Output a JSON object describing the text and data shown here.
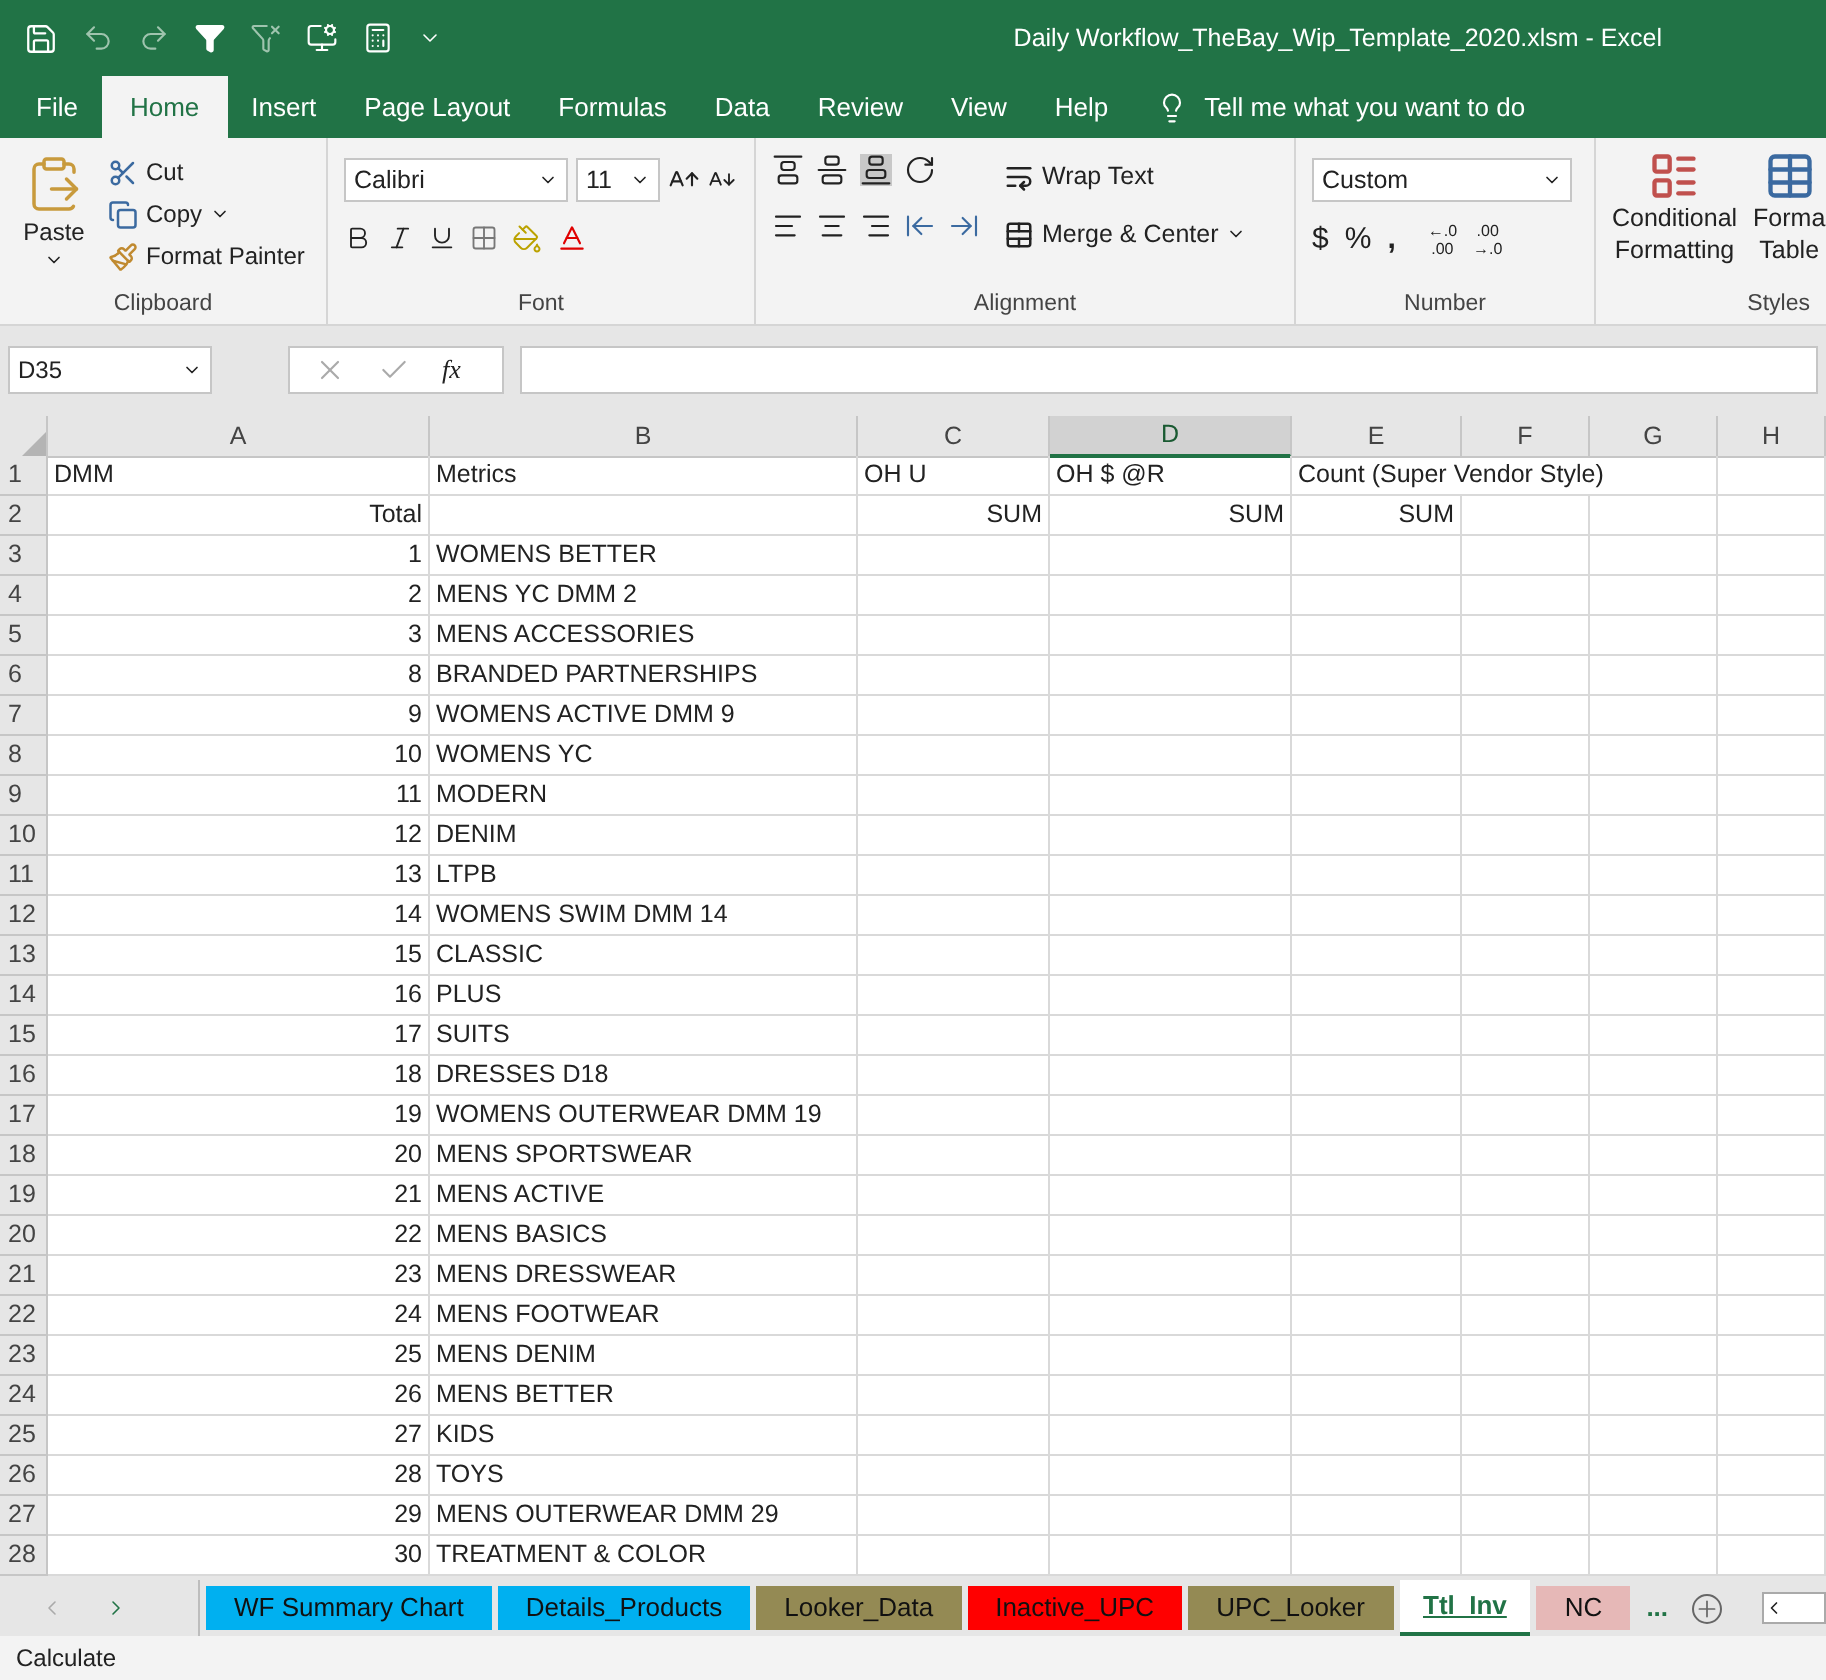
{
  "window": {
    "title": "Daily Workflow_TheBay_Wip_Template_2020.xlsm  -  Excel"
  },
  "menu_tabs": [
    {
      "label": "File",
      "selected": false
    },
    {
      "label": "Home",
      "selected": true
    },
    {
      "label": "Insert",
      "selected": false
    },
    {
      "label": "Page Layout",
      "selected": false
    },
    {
      "label": "Formulas",
      "selected": false
    },
    {
      "label": "Data",
      "selected": false
    },
    {
      "label": "Review",
      "selected": false
    },
    {
      "label": "View",
      "selected": false
    },
    {
      "label": "Help",
      "selected": false
    }
  ],
  "tell_me": "Tell me what you want to do",
  "ribbon": {
    "clipboard": {
      "label": "Clipboard",
      "paste": "Paste",
      "cut": "Cut",
      "copy": "Copy",
      "format_painter": "Format Painter"
    },
    "font": {
      "label": "Font",
      "font_name": "Calibri",
      "font_size": "11"
    },
    "alignment": {
      "label": "Alignment",
      "wrap_text": "Wrap Text",
      "merge_center": "Merge & Center"
    },
    "number": {
      "label": "Number",
      "format": "Custom",
      "currency": "$",
      "percent": "%",
      "comma": ",",
      "increase_decimal": [
        "←.0",
        ".00"
      ],
      "decrease_decimal": [
        ".00",
        "→.0"
      ]
    },
    "styles": {
      "label": "Styles",
      "conditional_formatting": [
        "Conditional",
        "Formatting"
      ],
      "format_as_table": [
        "Forma",
        "Table"
      ]
    }
  },
  "name_box": "D35",
  "fx": "fx",
  "columns": [
    {
      "label": "A",
      "selected": false
    },
    {
      "label": "B",
      "selected": false
    },
    {
      "label": "C",
      "selected": false
    },
    {
      "label": "D",
      "selected": true
    },
    {
      "label": "E",
      "selected": false
    },
    {
      "label": "F",
      "selected": false
    },
    {
      "label": "G",
      "selected": false
    },
    {
      "label": "H",
      "selected": false
    }
  ],
  "rows": [
    {
      "header": "1",
      "kind": "heading",
      "a": "DMM",
      "b": "Metrics",
      "c": "OH U",
      "d": "OH $ @R",
      "e": "Count (Super Vendor Style)"
    },
    {
      "header": "2",
      "kind": "values",
      "a": "Total",
      "c": "SUM",
      "d": "SUM",
      "e": "SUM"
    },
    {
      "header": "3",
      "kind": "values",
      "a": "1",
      "b": "WOMENS BETTER"
    },
    {
      "header": "4",
      "kind": "values",
      "a": "2",
      "b": "MENS YC DMM 2"
    },
    {
      "header": "5",
      "kind": "values",
      "a": "3",
      "b": "MENS ACCESSORIES"
    },
    {
      "header": "6",
      "kind": "values",
      "a": "8",
      "b": "BRANDED PARTNERSHIPS"
    },
    {
      "header": "7",
      "kind": "values",
      "a": "9",
      "b": "WOMENS ACTIVE DMM 9"
    },
    {
      "header": "8",
      "kind": "values",
      "a": "10",
      "b": "WOMENS YC"
    },
    {
      "header": "9",
      "kind": "values",
      "a": "11",
      "b": "MODERN"
    },
    {
      "header": "10",
      "kind": "values",
      "a": "12",
      "b": "DENIM"
    },
    {
      "header": "11",
      "kind": "values",
      "a": "13",
      "b": "LTPB"
    },
    {
      "header": "12",
      "kind": "values",
      "a": "14",
      "b": "WOMENS SWIM DMM 14"
    },
    {
      "header": "13",
      "kind": "values",
      "a": "15",
      "b": "CLASSIC"
    },
    {
      "header": "14",
      "kind": "values",
      "a": "16",
      "b": "PLUS"
    },
    {
      "header": "15",
      "kind": "values",
      "a": "17",
      "b": "SUITS"
    },
    {
      "header": "16",
      "kind": "values",
      "a": "18",
      "b": "DRESSES D18"
    },
    {
      "header": "17",
      "kind": "values",
      "a": "19",
      "b": "WOMENS OUTERWEAR DMM 19"
    },
    {
      "header": "18",
      "kind": "values",
      "a": "20",
      "b": "MENS SPORTSWEAR"
    },
    {
      "header": "19",
      "kind": "values",
      "a": "21",
      "b": "MENS ACTIVE"
    },
    {
      "header": "20",
      "kind": "values",
      "a": "22",
      "b": "MENS BASICS"
    },
    {
      "header": "21",
      "kind": "values",
      "a": "23",
      "b": "MENS DRESSWEAR"
    },
    {
      "header": "22",
      "kind": "values",
      "a": "24",
      "b": "MENS FOOTWEAR"
    },
    {
      "header": "23",
      "kind": "values",
      "a": "25",
      "b": "MENS DENIM"
    },
    {
      "header": "24",
      "kind": "values",
      "a": "26",
      "b": "MENS BETTER"
    },
    {
      "header": "25",
      "kind": "values",
      "a": "27",
      "b": "KIDS"
    },
    {
      "header": "26",
      "kind": "values",
      "a": "28",
      "b": "TOYS"
    },
    {
      "header": "27",
      "kind": "values",
      "a": "29",
      "b": "MENS OUTERWEAR DMM 29"
    },
    {
      "header": "28",
      "kind": "values",
      "a": "30",
      "b": "TREATMENT & COLOR"
    }
  ],
  "sheet_tabs": [
    {
      "label": "WF Summary Chart",
      "color": "#00b0f0",
      "selected": false
    },
    {
      "label": "Details_Products",
      "color": "#00b0f0",
      "selected": false
    },
    {
      "label": "Looker_Data",
      "color": "#948a54",
      "selected": false
    },
    {
      "label": "Inactive_UPC",
      "color": "#ff0000",
      "selected": false
    },
    {
      "label": "UPC_Looker",
      "color": "#948a54",
      "selected": false
    },
    {
      "label": "Ttl_Inv",
      "color": "#ffffff",
      "selected": true
    },
    {
      "label": "NC",
      "color": "#e6b8b7",
      "selected": false
    }
  ],
  "more_tabs": "...",
  "status_bar": "Calculate"
}
